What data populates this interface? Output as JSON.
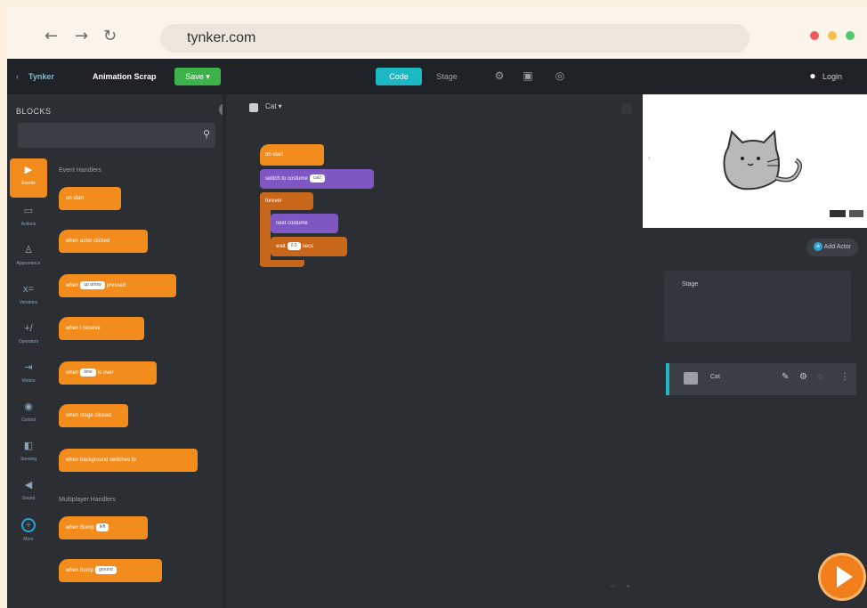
{
  "browser": {
    "back_icon": "arrow-left-icon",
    "forward_icon": "arrow-right-icon",
    "reload_icon": "reload-icon",
    "url": "tynker.com",
    "window_dots": [
      "#f05a5a",
      "#f5c04a",
      "#4fc76a"
    ]
  },
  "topbar": {
    "logo": "Tynker",
    "project_title": "Animation Scrap",
    "save_label": "Save",
    "code_tab": "Code",
    "stage_tab": "Stage",
    "login_label": "Login"
  },
  "blocks_panel": {
    "header": "BLOCKS",
    "search_placeholder": "",
    "categories": [
      {
        "label": "Events",
        "icon": "play-icon",
        "active": true
      },
      {
        "label": "Actions",
        "icon": "square-icon"
      },
      {
        "label": "Appearance",
        "icon": "person-icon"
      },
      {
        "label": "Variables",
        "icon": "var-icon"
      },
      {
        "label": "Operators",
        "icon": "operator-icon"
      },
      {
        "label": "Motion",
        "icon": "motion-icon"
      },
      {
        "label": "Control",
        "icon": "control-icon"
      },
      {
        "label": "Sensing",
        "icon": "sensing-icon"
      },
      {
        "label": "Sound",
        "icon": "sound-icon"
      },
      {
        "label": "More",
        "icon": "plus-icon"
      }
    ],
    "section_events": "Event Handlers",
    "blocks": [
      {
        "text": "on start"
      },
      {
        "text": "when actor clicked"
      },
      {
        "text": "when",
        "pill": "up arrow",
        "suffix": "pressed"
      },
      {
        "text": "when I receive",
        "pill": " "
      },
      {
        "text": "when",
        "pill": "time",
        "suffix": "is over"
      },
      {
        "text": "when stage clicked"
      },
      {
        "text": "when background switches to",
        "pill": " "
      }
    ],
    "section_physics": "Multiplayer Handlers",
    "blocks2": [
      {
        "text": "when Bump",
        "pill": "left"
      },
      {
        "text": "when bump",
        "pill": "ground"
      }
    ]
  },
  "workspace": {
    "actor_name": "Cat",
    "script": [
      {
        "text": "on start",
        "color": "#f28c1d"
      },
      {
        "text": "switch to costume",
        "pill": "cat2",
        "color": "#7e57c2"
      },
      {
        "text": "forever",
        "color": "#c8661a"
      },
      {
        "text": "next costume",
        "color": "#7e57c2"
      },
      {
        "text": "wait",
        "pill": "0.5",
        "suffix": "secs",
        "color": "#c8661a"
      }
    ]
  },
  "stage": {
    "add_actor_label": "Add Actor",
    "actors_header": "Stage",
    "actor_row_name": "Cat"
  },
  "colors": {
    "accent_teal": "#1cb8c4",
    "save_green": "#3cb24a",
    "event_orange": "#f28c1d"
  }
}
